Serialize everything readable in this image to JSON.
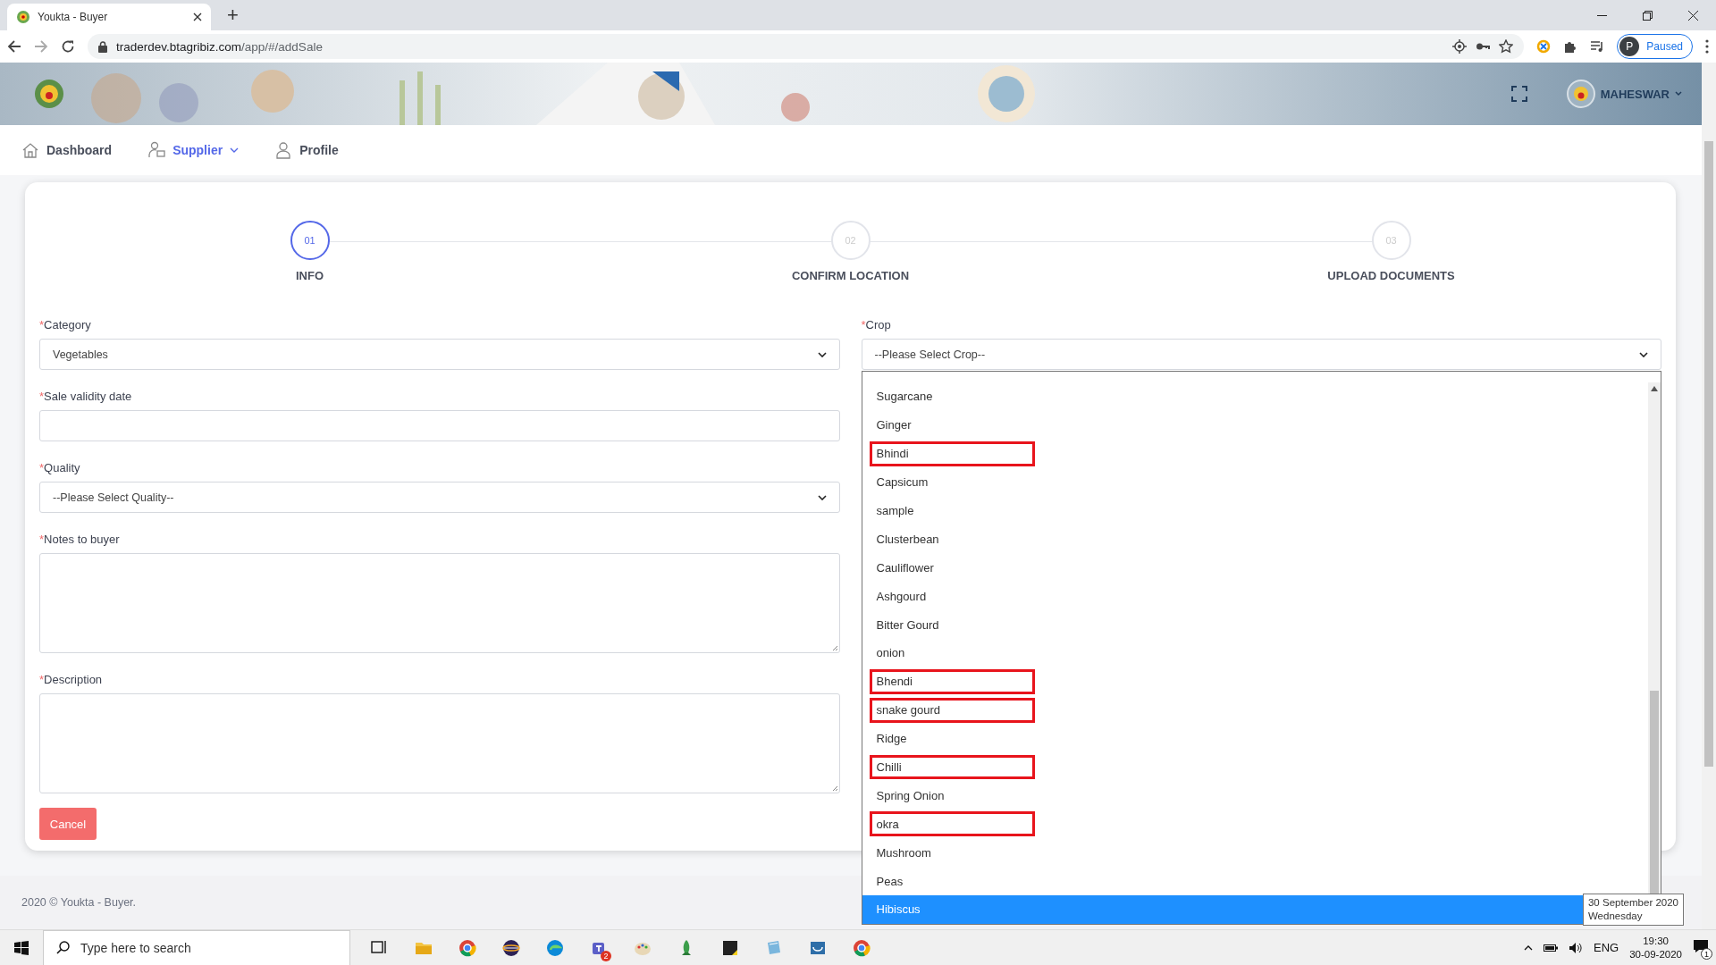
{
  "browser": {
    "tab_title": "Youkta - Buyer",
    "new_tab": "+",
    "url_host": "traderdev.btagribiz.com",
    "url_path": "/app/#/addSale",
    "profile_initial": "P",
    "profile_status": "Paused"
  },
  "header": {
    "user": "MAHESWAR"
  },
  "nav": [
    {
      "label": "Dashboard",
      "selected": false,
      "has_menu": false
    },
    {
      "label": "Supplier",
      "selected": true,
      "has_menu": true
    },
    {
      "label": "Profile",
      "selected": false,
      "has_menu": false
    }
  ],
  "steps": [
    {
      "number": "01",
      "label": "INFO",
      "selected": true
    },
    {
      "number": "02",
      "label": "CONFIRM LOCATION",
      "selected": false
    },
    {
      "number": "03",
      "label": "UPLOAD DOCUMENTS",
      "selected": false
    }
  ],
  "form": {
    "fields": [
      {
        "mark": "*",
        "label": "Category",
        "kind": "select",
        "value": "Vegetables"
      },
      {
        "mark": "*",
        "label": "Sale validity date",
        "kind": "input"
      },
      {
        "mark": "*",
        "label": "Quality",
        "kind": "select",
        "value": "--Please Select Quality--"
      },
      {
        "mark": "*",
        "label": "Notes to buyer",
        "kind": "textarea"
      },
      {
        "mark": "*",
        "label": "Description",
        "kind": "textarea"
      }
    ],
    "crop": {
      "mark": "*",
      "label": "Crop",
      "value": "--Please Select Crop--",
      "options": [
        {
          "label": "Sugarcane",
          "selected": false,
          "marked": false
        },
        {
          "label": "Ginger",
          "selected": false,
          "marked": false
        },
        {
          "label": "Bhindi",
          "selected": false,
          "marked": true
        },
        {
          "label": "Capsicum",
          "selected": false,
          "marked": false
        },
        {
          "label": "sample",
          "selected": false,
          "marked": false
        },
        {
          "label": "Clusterbean",
          "selected": false,
          "marked": false
        },
        {
          "label": "Cauliflower",
          "selected": false,
          "marked": false
        },
        {
          "label": "Ashgourd",
          "selected": false,
          "marked": false
        },
        {
          "label": "Bitter Gourd",
          "selected": false,
          "marked": false
        },
        {
          "label": "onion",
          "selected": false,
          "marked": false
        },
        {
          "label": "Bhendi",
          "selected": false,
          "marked": true
        },
        {
          "label": "snake gourd",
          "selected": false,
          "marked": true
        },
        {
          "label": "Ridge",
          "selected": false,
          "marked": false
        },
        {
          "label": "Chilli",
          "selected": false,
          "marked": true
        },
        {
          "label": "Spring Onion",
          "selected": false,
          "marked": false
        },
        {
          "label": "okra",
          "selected": false,
          "marked": true
        },
        {
          "label": "Mushroom",
          "selected": false,
          "marked": false
        },
        {
          "label": "Peas",
          "selected": false,
          "marked": false
        },
        {
          "label": "Hibiscus",
          "selected": true,
          "marked": false
        }
      ]
    },
    "cancel": "Cancel"
  },
  "footer": "2020 © Youkta - Buyer.",
  "tooltip": {
    "lines": [
      "30 September 2020",
      "Wednesday"
    ]
  },
  "taskbar": {
    "search_placeholder": "Type here to search",
    "app_badge": "2",
    "language": "ENG",
    "time": "19:30",
    "date": "30-09-2020",
    "notifications": "1"
  }
}
